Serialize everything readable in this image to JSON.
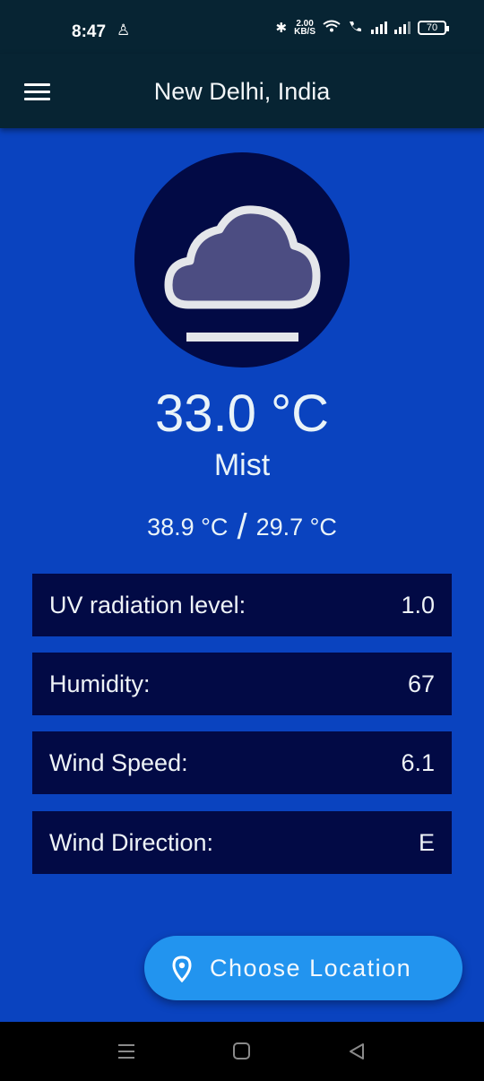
{
  "status_bar": {
    "time": "8:47",
    "net_speed_value": "2.00",
    "net_speed_unit": "KB/S",
    "battery": "70"
  },
  "app_bar": {
    "title": "New Delhi, India"
  },
  "weather": {
    "icon": "mist-cloud-icon",
    "temperature": "33.0 °C",
    "condition": "Mist",
    "max_temp": "38.9 °C",
    "separator": "/",
    "min_temp": "29.7 °C"
  },
  "details": [
    {
      "label": "UV radiation level:",
      "value": "1.0"
    },
    {
      "label": "Humidity:",
      "value": "67"
    },
    {
      "label": "Wind Speed:",
      "value": "6.1"
    },
    {
      "label": "Wind Direction:",
      "value": "E"
    }
  ],
  "fab": {
    "label": "Choose Location",
    "icon": "location-pin-icon"
  },
  "colors": {
    "background": "#0a43bf",
    "app_bar": "#072433",
    "card": "#020a45",
    "fab": "#2294ef"
  }
}
